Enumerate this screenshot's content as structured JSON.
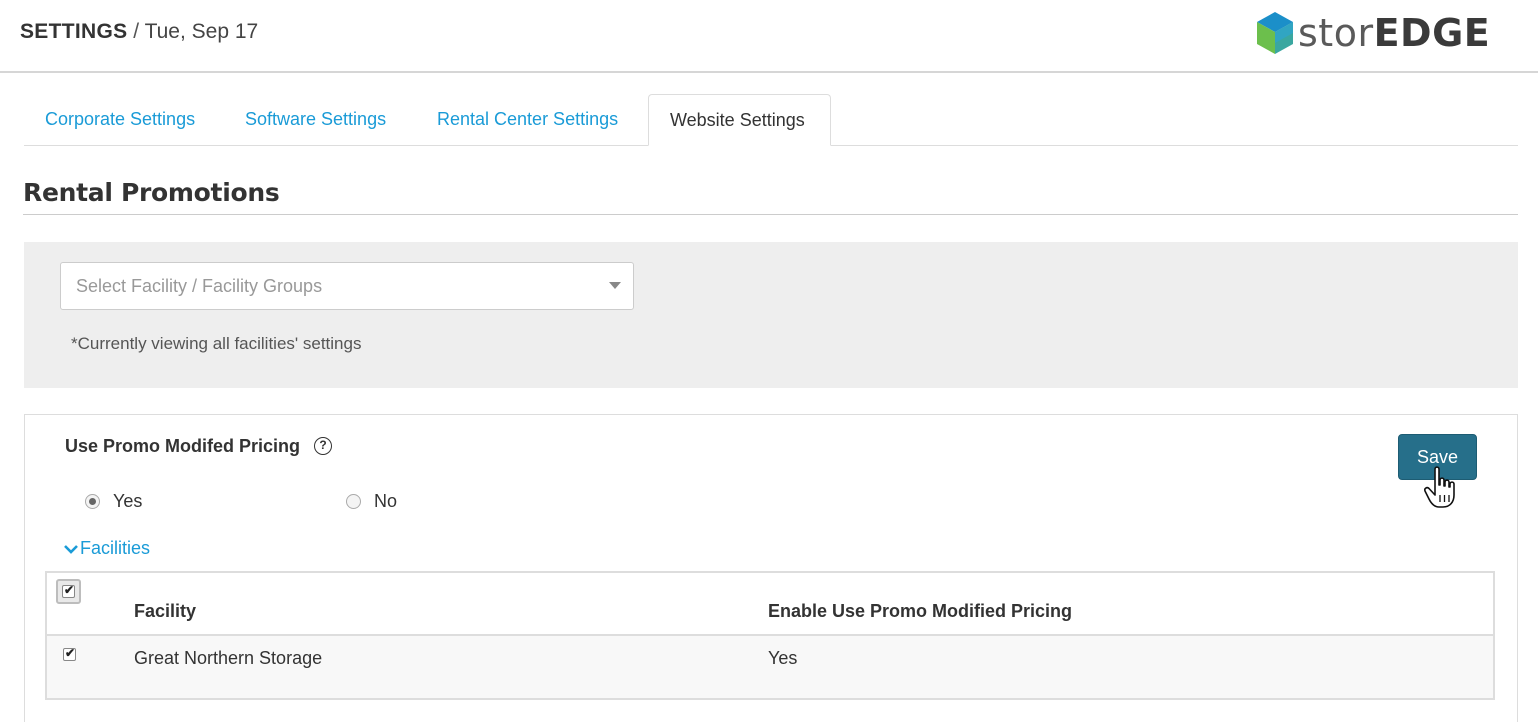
{
  "header": {
    "section": "SETTINGS",
    "separator": "/",
    "date": "Tue, Sep 17",
    "logo": {
      "light": "stor",
      "bold": "EDGE"
    }
  },
  "tabs": [
    {
      "label": "Corporate Settings",
      "active": false
    },
    {
      "label": "Software Settings",
      "active": false
    },
    {
      "label": "Rental Center Settings",
      "active": false
    },
    {
      "label": "Website Settings",
      "active": true
    }
  ],
  "page_title": "Rental Promotions",
  "filter": {
    "placeholder": "Select Facility / Facility Groups",
    "note": "*Currently viewing all facilities' settings"
  },
  "promo": {
    "label": "Use Promo Modifed Pricing",
    "help_icon": "question-circle-icon",
    "options": [
      {
        "label": "Yes",
        "selected": true
      },
      {
        "label": "No",
        "selected": false
      }
    ],
    "save_label": "Save"
  },
  "facilities": {
    "toggle_label": "Facilities",
    "columns": [
      "Facility",
      "Enable Use Promo Modified Pricing"
    ],
    "rows": [
      {
        "checked": true,
        "facility": "Great Northern Storage",
        "enabled": "Yes"
      }
    ]
  },
  "colors": {
    "link": "#1a9bd7",
    "button": "#266f8a",
    "panel": "#eeeeee"
  }
}
